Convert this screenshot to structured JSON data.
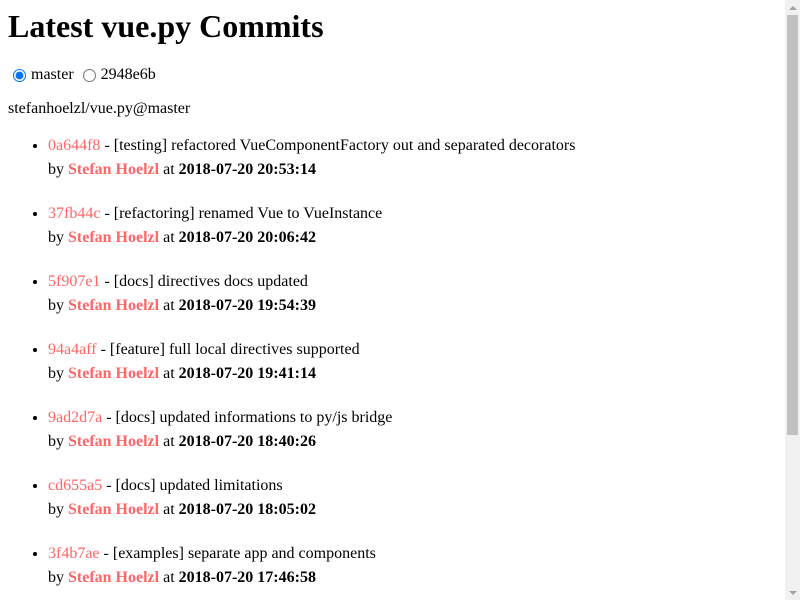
{
  "page": {
    "title": "Latest vue.py Commits",
    "repo_label": "stefanhoelzl/vue.py@master"
  },
  "branches": [
    {
      "value": "master",
      "label": "master",
      "checked": true
    },
    {
      "value": "2948e6b",
      "label": "2948e6b",
      "checked": false
    }
  ],
  "commit_labels": {
    "by": "by",
    "at": "at",
    "separator": " - "
  },
  "commits": [
    {
      "sha": "0a644f8",
      "message": "[testing] refactored VueComponentFactory out and separated decorators",
      "author": "Stefan Hoelzl",
      "date": "2018-07-20 20:53:14"
    },
    {
      "sha": "37fb44c",
      "message": "[refactoring] renamed Vue to VueInstance",
      "author": "Stefan Hoelzl",
      "date": "2018-07-20 20:06:42"
    },
    {
      "sha": "5f907e1",
      "message": "[docs] directives docs updated",
      "author": "Stefan Hoelzl",
      "date": "2018-07-20 19:54:39"
    },
    {
      "sha": "94a4aff",
      "message": "[feature] full local directives supported",
      "author": "Stefan Hoelzl",
      "date": "2018-07-20 19:41:14"
    },
    {
      "sha": "9ad2d7a",
      "message": "[docs] updated informations to py/js bridge",
      "author": "Stefan Hoelzl",
      "date": "2018-07-20 18:40:26"
    },
    {
      "sha": "cd655a5",
      "message": "[docs] updated limitations",
      "author": "Stefan Hoelzl",
      "date": "2018-07-20 18:05:02"
    },
    {
      "sha": "3f4b7ae",
      "message": "[examples] separate app and components",
      "author": "Stefan Hoelzl",
      "date": "2018-07-20 17:46:58"
    }
  ],
  "colors": {
    "link": "#ff6666",
    "scrollbar_track": "#f1f1f1",
    "scrollbar_thumb": "#c1c1c1"
  },
  "icons": {
    "scroll_up": "triangle-up-icon",
    "scroll_down": "triangle-down-icon"
  }
}
